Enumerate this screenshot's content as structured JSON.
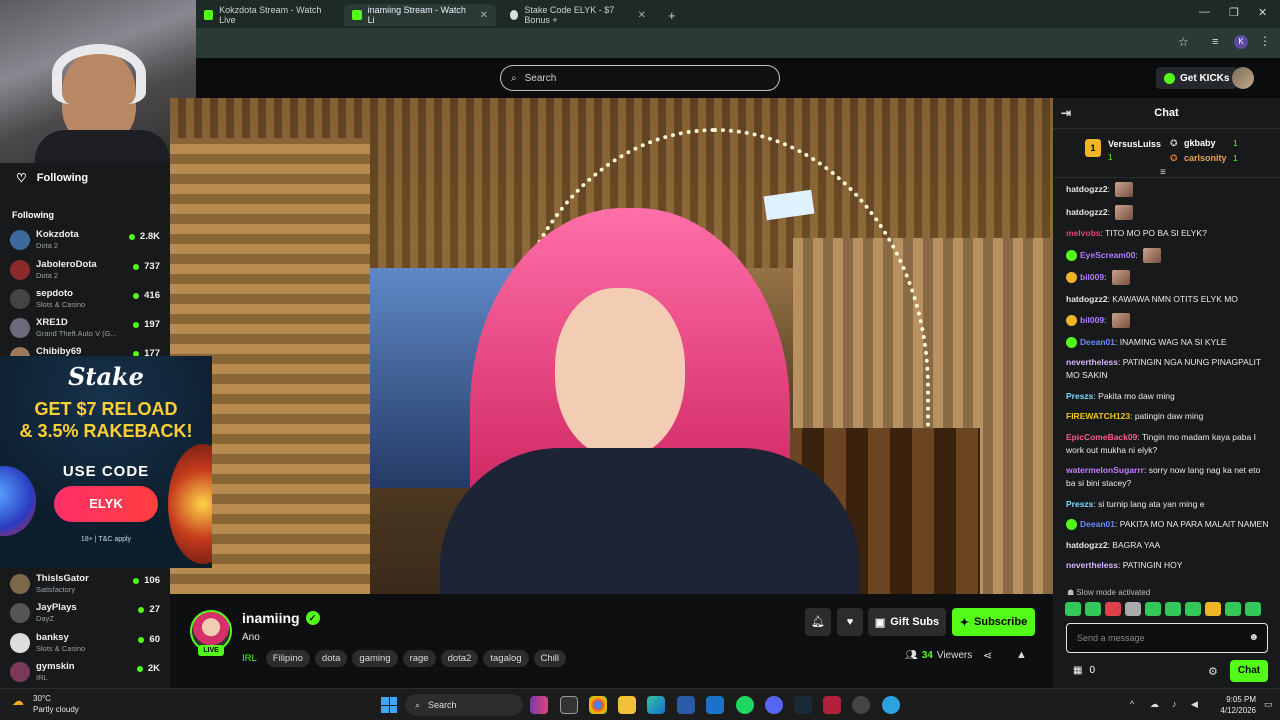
{
  "browser": {
    "tabs": [
      {
        "title": "Kokzdota Stream - Watch Live",
        "color": "#53fc18"
      },
      {
        "title": "inamiing Stream - Watch Li",
        "color": "#53fc18"
      },
      {
        "title": "Stake Code ELYK - $7 Bonus +",
        "color": "#d7dde0"
      }
    ],
    "new_tab": "+",
    "profile_initial": "K"
  },
  "header": {
    "search_placeholder": "Search",
    "get_kicks_label": "Get KICKs"
  },
  "sidebar": {
    "following_label": "Following",
    "section_title": "Following",
    "channels_top": [
      {
        "name": "Kokzdota",
        "category": "Dota 2",
        "viewers": "2.8K",
        "color": "#3a6b9c"
      },
      {
        "name": "JaboleroDota",
        "category": "Dota 2",
        "viewers": "737",
        "color": "#8a2a2a"
      },
      {
        "name": "sepdoto",
        "category": "Slots & Casino",
        "viewers": "416",
        "color": "#444"
      },
      {
        "name": "XRE1D",
        "category": "Grand Theft Auto V (G...",
        "viewers": "197",
        "color": "#6a6a7a"
      },
      {
        "name": "Chibiby69",
        "category": "",
        "viewers": "177",
        "color": "#9a7a5a"
      }
    ],
    "channels_bottom": [
      {
        "name": "ThisIsGator",
        "category": "Satisfactory",
        "viewers": "106",
        "color": "#7a6a4a"
      },
      {
        "name": "JayPlays",
        "category": "DayZ",
        "viewers": "27",
        "color": "#555"
      },
      {
        "name": "banksy",
        "category": "Slots & Casino",
        "viewers": "60",
        "color": "#ddd"
      },
      {
        "name": "gymskin",
        "category": "IRL",
        "viewers": "2K",
        "color": "#7a3a5a"
      }
    ]
  },
  "ad": {
    "brand": "Stake",
    "headline_1": "GET $7 RELOAD",
    "headline_2": "& 3.5% RAKEBACK!",
    "use_code": "USE CODE",
    "code": "ELYK",
    "terms": "18+ | T&C apply"
  },
  "stream": {
    "streamer": "inamiing",
    "live_label": "LIVE",
    "title": "Ano",
    "category": "IRL",
    "tags": [
      "Filipino",
      "dota",
      "gaming",
      "rage",
      "dota2",
      "tagalog",
      "Chill"
    ],
    "gift_subs_label": "Gift Subs",
    "subscribe_label": "Subscribe",
    "viewers_count": "34",
    "viewers_label": "Viewers"
  },
  "chat": {
    "title": "Chat",
    "leaderboard": [
      {
        "name": "VersusLuiss",
        "count": "1",
        "rank": "1"
      },
      {
        "name": "gkbaby",
        "count": "1"
      },
      {
        "name": "carlsonity",
        "count": "1"
      }
    ],
    "messages": [
      {
        "user": "hatdogzz2",
        "text": "",
        "color": "#e6e6e6",
        "emote": true
      },
      {
        "user": "hatdogzz2",
        "text": "",
        "color": "#e6e6e6",
        "emote": true
      },
      {
        "user": "melvobs",
        "text": "TITO MO PO BA SI ELYK?",
        "color": "#e0457b"
      },
      {
        "user": "EyeScream00",
        "text": "",
        "color": "#b07cff",
        "emote": true,
        "badge": "#53fc18"
      },
      {
        "user": "bil009",
        "text": "",
        "color": "#b07cff",
        "emote": true,
        "badge": "#f0b429"
      },
      {
        "user": "hatdogzz2",
        "text": "KAWAWA NMN OTITS ELYK MO",
        "color": "#e6e6e6"
      },
      {
        "user": "bil009",
        "text": "",
        "color": "#b07cff",
        "emote": true,
        "badge": "#f0b429"
      },
      {
        "user": "Deean01",
        "text": "INAMING WAG NA SI KYLE",
        "color": "#6a8cff",
        "badge": "#53fc18"
      },
      {
        "user": "nevertheless",
        "text": "PATINGIN NGA NUNG PINAGPALIT MO SAKIN",
        "color": "#d8b4ff"
      },
      {
        "user": "Preszs",
        "text": "Pakita mo daw ming",
        "color": "#7fd8ff"
      },
      {
        "user": "FIREWATCH123",
        "text": "patingin daw ming",
        "color": "#f0c419"
      },
      {
        "user": "EpicComeBack09",
        "text": "Tingin mo madam kaya paba I work out mukha ni elyk?",
        "color": "#ff5a8a"
      },
      {
        "user": "watermelonSugarrr",
        "text": "sorry now lang nag ka net eto ba si bini stacey?",
        "color": "#c77dff"
      },
      {
        "user": "Preszs",
        "text": "si turnip lang ata yan ming e",
        "color": "#7fd8ff"
      },
      {
        "user": "Deean01",
        "text": "PAKITA MO NA PARA MALAIT NAMEN",
        "color": "#6a8cff",
        "badge": "#53fc18"
      },
      {
        "user": "hatdogzz2",
        "text": "BAGRA YAA",
        "color": "#e6e6e6"
      },
      {
        "user": "nevertheless",
        "text": "PATINGIN HOY",
        "color": "#d8b4ff"
      }
    ],
    "slow_mode": "Slow mode activated",
    "input_placeholder": "Send a message",
    "kicks_count": "0",
    "send_label": "Chat"
  },
  "taskbar": {
    "weather_temp": "30°C",
    "weather_desc": "Partly cloudy",
    "search_label": "Search",
    "time": "9:05 PM",
    "date": "4/12/2026"
  }
}
